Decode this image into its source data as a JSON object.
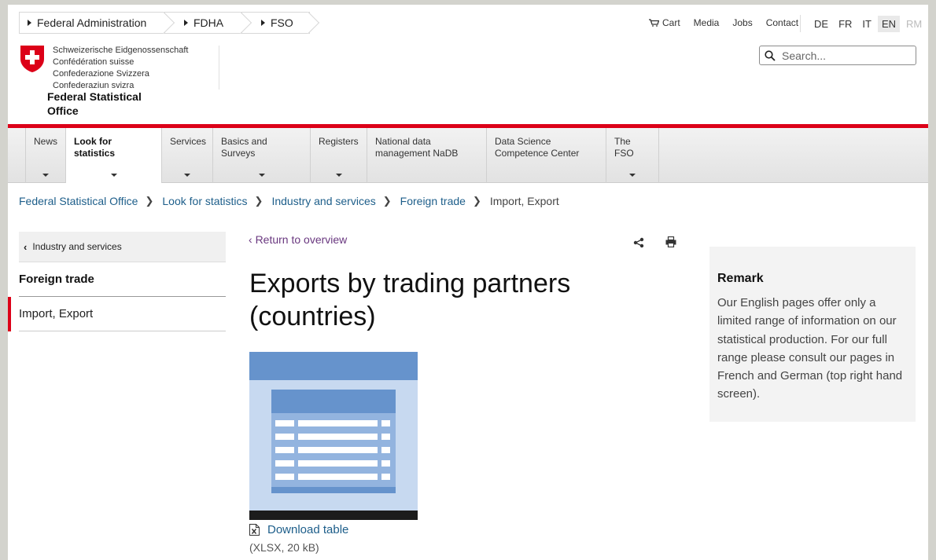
{
  "top_breadcrumb": [
    "Federal Administration",
    "FDHA",
    "FSO"
  ],
  "service_links": {
    "cart": "Cart",
    "media": "Media",
    "jobs": "Jobs",
    "contact": "Contact"
  },
  "languages": [
    {
      "code": "DE",
      "state": "normal"
    },
    {
      "code": "FR",
      "state": "normal"
    },
    {
      "code": "IT",
      "state": "normal"
    },
    {
      "code": "EN",
      "state": "active"
    },
    {
      "code": "RM",
      "state": "disabled"
    }
  ],
  "logo": {
    "lines": [
      "Schweizerische Eidgenossenschaft",
      "Confédération suisse",
      "Confederazione Svizzera",
      "Confederaziun svizra"
    ],
    "office": "Federal Statistical Office"
  },
  "search": {
    "placeholder": "Search..."
  },
  "nav": [
    {
      "label": "News",
      "active": false,
      "caret": true
    },
    {
      "label": "Look for statistics",
      "active": true,
      "caret": true
    },
    {
      "label": "Services",
      "active": false,
      "caret": true
    },
    {
      "label": "Basics and Surveys",
      "active": false,
      "caret": true
    },
    {
      "label": "Registers",
      "active": false,
      "caret": true
    },
    {
      "label": "National data management NaDB",
      "active": false,
      "caret": false
    },
    {
      "label": "Data Science Competence Center",
      "active": false,
      "caret": false
    },
    {
      "label": "The FSO",
      "active": false,
      "caret": true
    }
  ],
  "breadcrumb": {
    "links": [
      "Federal Statistical Office",
      "Look for statistics",
      "Industry and services",
      "Foreign trade"
    ],
    "current": "Import, Export"
  },
  "left_nav": {
    "back": "Industry and services",
    "heading": "Foreign trade",
    "items": [
      {
        "label": "Import, Export",
        "selected": true
      }
    ]
  },
  "main": {
    "return_link": "Return to overview",
    "title": "Exports by trading partners (countries)",
    "download_label": "Download table",
    "file_meta": "(XLSX, 20 kB)"
  },
  "remark": {
    "heading": "Remark",
    "text": "Our English pages offer only a limited range of information on our statistical production. For our full range please consult our pages in French and German (top right hand screen)."
  },
  "colors": {
    "accent_red": "#dc0018",
    "link_blue": "#1d5e8a",
    "return_purple": "#69377f"
  }
}
